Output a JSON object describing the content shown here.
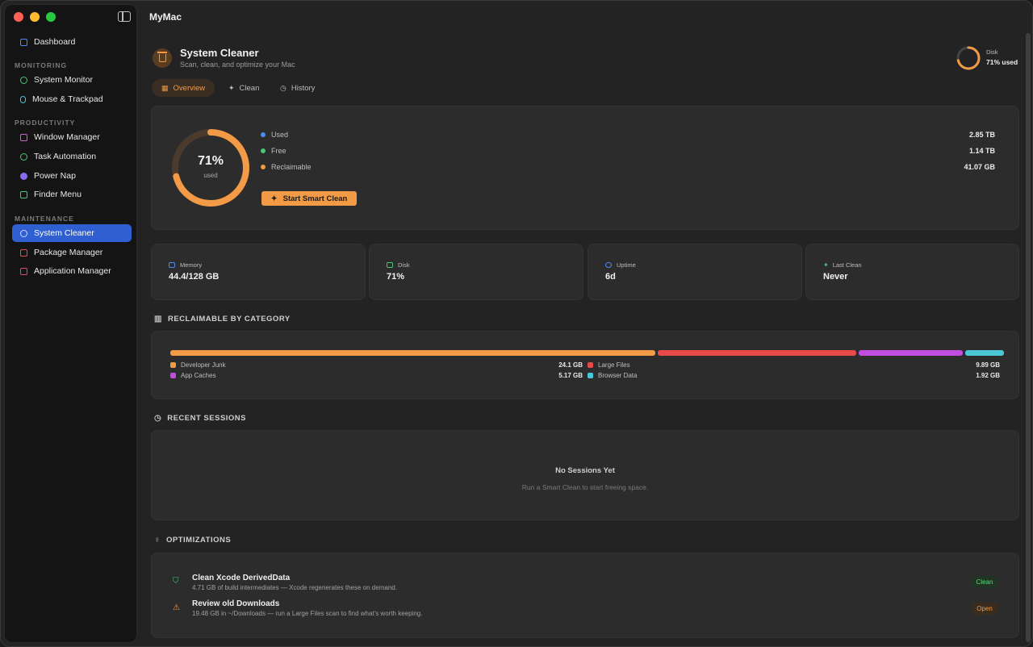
{
  "app_title": "MyMac",
  "sidebar": {
    "top_item": {
      "label": "Dashboard"
    },
    "sections": [
      {
        "title": "MONITORING"
      },
      {
        "title": "PRODUCTIVITY"
      },
      {
        "title": "MAINTENANCE"
      }
    ],
    "items": [
      {
        "label": "System Monitor"
      },
      {
        "label": "Mouse & Trackpad"
      },
      {
        "label": "Window Manager"
      },
      {
        "label": "Task Automation"
      },
      {
        "label": "Power Nap"
      },
      {
        "label": "Finder Menu"
      },
      {
        "label": "System Cleaner"
      },
      {
        "label": "Package Manager"
      },
      {
        "label": "Application Manager"
      }
    ]
  },
  "header": {
    "title": "System Cleaner",
    "subtitle": "Scan, clean, and optimize your Mac",
    "disk_label": "Disk",
    "disk_value": "71% used"
  },
  "tabs": [
    {
      "label": "Overview"
    },
    {
      "label": "Clean"
    },
    {
      "label": "History"
    }
  ],
  "usage": {
    "percent_label": "71%",
    "percent_sub": "used",
    "percent_fraction": 0.71,
    "legend": [
      {
        "label": "Used",
        "value": "2.85 TB",
        "color": "#4a8cf0"
      },
      {
        "label": "Free",
        "value": "1.14 TB",
        "color": "#48c774"
      },
      {
        "label": "Reclaimable",
        "value": "41.07 GB",
        "color": "#f29a45"
      }
    ],
    "button_label": "Start Smart Clean"
  },
  "stats": [
    {
      "label": "Memory",
      "value": "44.4/128 GB"
    },
    {
      "label": "Disk",
      "value": "71%"
    },
    {
      "label": "Uptime",
      "value": "6d"
    },
    {
      "label": "Last Clean",
      "value": "Never"
    }
  ],
  "categories": {
    "title": "RECLAIMABLE BY CATEGORY",
    "items": [
      {
        "label": "Developer Junk",
        "value": "24.1 GB",
        "color": "#f29a45",
        "gb": 24.1
      },
      {
        "label": "Large Files",
        "value": "9.89 GB",
        "color": "#e84a4a",
        "gb": 9.89
      },
      {
        "label": "App Caches",
        "value": "5.17 GB",
        "color": "#c24ee0",
        "gb": 5.17
      },
      {
        "label": "Browser Data",
        "value": "1.92 GB",
        "color": "#4bc6d6",
        "gb": 1.92
      }
    ]
  },
  "sessions": {
    "title": "RECENT SESSIONS",
    "empty_title": "No Sessions Yet",
    "empty_sub": "Run a Smart Clean to start freeing space."
  },
  "optimizations": {
    "title": "OPTIMIZATIONS",
    "items": [
      {
        "title": "Clean Xcode DerivedData",
        "sub": "4.71 GB of build intermediates — Xcode regenerates these on demand.",
        "action": "Clean"
      },
      {
        "title": "Review old Downloads",
        "sub": "19.48 GB in ~/Downloads — run a Large Files scan to find what's worth keeping.",
        "action": "Open"
      }
    ]
  }
}
